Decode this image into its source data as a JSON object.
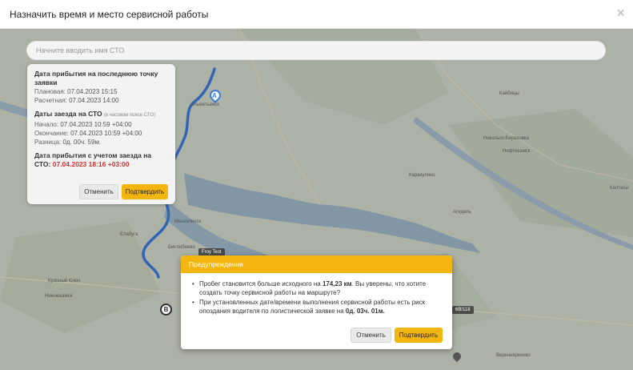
{
  "header": {
    "title": "Назначить время и место сервисной работы",
    "close": "×"
  },
  "search": {
    "placeholder": "Начните вводить имя СТО"
  },
  "info_card": {
    "arrival_title": "Дата прибытия на последнюю точку заявки",
    "planned_label": "Плановая:",
    "planned_value": "07.04.2023 15:15",
    "estimated_label": "Расчетная:",
    "estimated_value": "07.04.2023 14:00",
    "sto_title": "Даты заезда на СТО",
    "sto_tz_note": "(в часовом поясе СТО)",
    "start_label": "Начало:",
    "start_value": "07.04.2023 10:59 +04:00",
    "end_label": "Окончание:",
    "end_value": "07.04.2023 10:59 +04:00",
    "diff_label": "Разница:",
    "diff_value": "0д. 00ч. 59м.",
    "arrival_with_sto_title": "Дата прибытия с учетом заезда на СТО:",
    "arrival_with_sto_value": "07.04.2023 18:16 +03:00",
    "cancel_label": "Отменить",
    "confirm_label": "Подтвердить"
  },
  "map": {
    "marker_a": "A",
    "marker_b": "B",
    "tag_label": "Froy Test",
    "tag_right": "6B/118",
    "labels": {
      "kaybitsy": "Кайбицы",
      "nikolo": "Никольск-Березовка",
      "neftekamsk": "Нефтекамск",
      "karakulino": "Каракулино",
      "agidel": "Агидель",
      "kalta": "Калтасы",
      "elabuga": "Елабуга",
      "nizhnekamsk": "Нижнекамск",
      "krasny_klyuch": "Красный Ключ",
      "verkhneyarkeevo": "Верхнеяркеево",
      "menzelinsk": "Мензелинск",
      "naberezh": "Набережные Челны",
      "almetyevsk": "Альметьевск",
      "biktyubeevo": "Биктюбеево"
    }
  },
  "dialog": {
    "title": "Предупреждение",
    "item1_pre": "Пробег становится больше исходного на ",
    "item1_bold": "174,23 км",
    "item1_post": ". Вы уверены, что хотите создать точку сервисной работы на маршруте?",
    "item2_pre": "При установленных дате/времени выполнения сервисной работы есть риск опоздания водителя по логистической заявке на ",
    "item2_bold": "0д. 03ч. 01м.",
    "item2_post": "",
    "cancel_label": "Отменить",
    "confirm_label": "Подтвердить"
  },
  "colors": {
    "accent": "#f3b610",
    "route": "#3b7ddd",
    "danger": "#d32f2f"
  }
}
